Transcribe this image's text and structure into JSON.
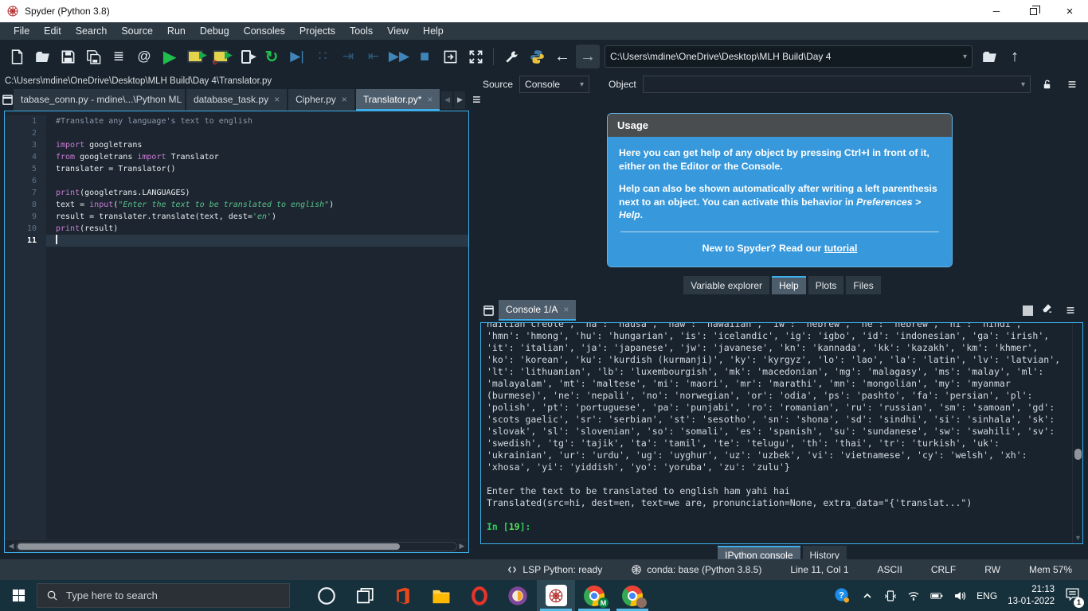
{
  "accent_color": "#3daee9",
  "usage_blue": "#3798dc",
  "window": {
    "title": "Spyder (Python 3.8)"
  },
  "menubar": {
    "items": [
      "File",
      "Edit",
      "Search",
      "Source",
      "Run",
      "Debug",
      "Consoles",
      "Projects",
      "Tools",
      "View",
      "Help"
    ]
  },
  "toolbar": {
    "icons_left": [
      {
        "name": "new-file-icon",
        "shape": "file"
      },
      {
        "name": "open-file-icon",
        "shape": "folder"
      },
      {
        "name": "save-icon",
        "shape": "save"
      },
      {
        "name": "save-all-icon",
        "shape": "saveall"
      },
      {
        "name": "outline-explorer-icon",
        "glyph": "≣",
        "cls": "glyph"
      },
      {
        "name": "symbol-finder-icon",
        "glyph": "@",
        "cls": "glyph"
      },
      {
        "name": "run-file-icon",
        "glyph": "▶",
        "cls": "glyph-green big"
      },
      {
        "name": "run-cell-icon",
        "shape": "cell"
      },
      {
        "name": "run-cell-advance-icon",
        "shape": "celladv"
      },
      {
        "name": "run-selection-icon",
        "shape": "runsel"
      },
      {
        "name": "rerun-icon",
        "glyph": "↻",
        "cls": "glyph-green big"
      },
      {
        "name": "debug-file-icon",
        "glyph": "▶|",
        "cls": "glyph-blue"
      },
      {
        "name": "debug-step-over-icon",
        "glyph": "∷",
        "cls": "glyph-dim"
      },
      {
        "name": "debug-step-into-icon",
        "glyph": "⇥",
        "cls": "glyph-dim"
      },
      {
        "name": "debug-step-return-icon",
        "glyph": "⇤",
        "cls": "glyph-dim"
      },
      {
        "name": "debug-continue-icon",
        "glyph": "▶▶",
        "cls": "glyph-blue"
      },
      {
        "name": "debug-stop-icon",
        "glyph": "■",
        "cls": "glyph-blue big"
      },
      {
        "name": "new-window-icon",
        "shape": "panebox"
      },
      {
        "name": "maximize-pane-icon",
        "shape": "expand"
      }
    ],
    "icons_mid": [
      {
        "name": "preferences-icon",
        "shape": "wrench"
      },
      {
        "name": "python-path-icon",
        "shape": "python"
      }
    ],
    "back_icon": "←",
    "forward_icon": "→",
    "working_dir": "C:\\Users\\mdine\\OneDrive\\Desktop\\MLH Build\\Day 4",
    "open_dir_icon": "folder",
    "up_dir_icon": "↑"
  },
  "editor": {
    "file_path": "C:\\Users\\mdine\\OneDrive\\Desktop\\MLH Build\\Day 4\\Translator.py",
    "tabs": [
      {
        "label": "tabase_conn.py - mdine\\...\\Python ML",
        "active": false
      },
      {
        "label": "database_task.py",
        "active": false
      },
      {
        "label": "Cipher.py",
        "active": false
      },
      {
        "label": "Translator.py*",
        "active": true
      }
    ],
    "current_line": 11,
    "lines": [
      {
        "n": 1,
        "tokens": [
          {
            "t": "cm",
            "s": "#Translate any language's text to english"
          }
        ]
      },
      {
        "n": 2,
        "tokens": []
      },
      {
        "n": 3,
        "tokens": [
          {
            "t": "kw",
            "s": "import"
          },
          {
            "t": "tx",
            "s": " googletrans"
          }
        ]
      },
      {
        "n": 4,
        "tokens": [
          {
            "t": "kw",
            "s": "from"
          },
          {
            "t": "tx",
            "s": " googletrans "
          },
          {
            "t": "kw",
            "s": "import"
          },
          {
            "t": "tx",
            "s": " Translator"
          }
        ]
      },
      {
        "n": 5,
        "tokens": [
          {
            "t": "tx",
            "s": "translater = Translator()"
          }
        ]
      },
      {
        "n": 6,
        "tokens": []
      },
      {
        "n": 7,
        "tokens": [
          {
            "t": "kw",
            "s": "print"
          },
          {
            "t": "tx",
            "s": "(googletrans.LANGUAGES)"
          }
        ]
      },
      {
        "n": 8,
        "tokens": [
          {
            "t": "tx",
            "s": "text = "
          },
          {
            "t": "kw",
            "s": "input"
          },
          {
            "t": "tx",
            "s": "("
          },
          {
            "t": "st",
            "s": "\"Enter the text to be translated to english\""
          },
          {
            "t": "tx",
            "s": ")"
          }
        ]
      },
      {
        "n": 9,
        "tokens": [
          {
            "t": "tx",
            "s": "result = translater.translate(text, dest="
          },
          {
            "t": "st",
            "s": "'en'"
          },
          {
            "t": "tx",
            "s": ")"
          }
        ]
      },
      {
        "n": 10,
        "tokens": [
          {
            "t": "kw",
            "s": "print"
          },
          {
            "t": "tx",
            "s": "(result)"
          }
        ]
      },
      {
        "n": 11,
        "tokens": []
      }
    ]
  },
  "help": {
    "source_label": "Source",
    "source_value": "Console",
    "object_label": "Object",
    "object_value": "",
    "usage": {
      "title": "Usage",
      "p1_pre": "Here you can get help of any object by pressing ",
      "p1_bold": "Ctrl+I",
      "p1_post": " in front of it, either on the Editor or the Console.",
      "p2_pre": "Help can also be shown automatically after writing a left parenthesis next to an object. You can activate this behavior in ",
      "p2_italic": "Preferences > Help",
      "p2_post": ".",
      "footer_pre": "New to Spyder? Read our ",
      "footer_link": "tutorial"
    },
    "tabs": [
      {
        "label": "Variable explorer",
        "active": false
      },
      {
        "label": "Help",
        "active": true
      },
      {
        "label": "Plots",
        "active": false
      },
      {
        "label": "Files",
        "active": false
      }
    ]
  },
  "console": {
    "tab_label": "Console 1/A",
    "lines": [
      "haitian creole', 'ha': 'hausa', 'haw': 'hawaiian', 'iw': 'hebrew', 'he': 'hebrew', 'hi': 'hindi',",
      "'hmn': 'hmong', 'hu': 'hungarian', 'is': 'icelandic', 'ig': 'igbo', 'id': 'indonesian', 'ga': 'irish',",
      "'it': 'italian', 'ja': 'japanese', 'jw': 'javanese', 'kn': 'kannada', 'kk': 'kazakh', 'km': 'khmer',",
      "'ko': 'korean', 'ku': 'kurdish (kurmanji)', 'ky': 'kyrgyz', 'lo': 'lao', 'la': 'latin', 'lv': 'latvian',",
      "'lt': 'lithuanian', 'lb': 'luxembourgish', 'mk': 'macedonian', 'mg': 'malagasy', 'ms': 'malay', 'ml':",
      "'malayalam', 'mt': 'maltese', 'mi': 'maori', 'mr': 'marathi', 'mn': 'mongolian', 'my': 'myanmar",
      "(burmese)', 'ne': 'nepali', 'no': 'norwegian', 'or': 'odia', 'ps': 'pashto', 'fa': 'persian', 'pl':",
      "'polish', 'pt': 'portuguese', 'pa': 'punjabi', 'ro': 'romanian', 'ru': 'russian', 'sm': 'samoan', 'gd':",
      "'scots gaelic', 'sr': 'serbian', 'st': 'sesotho', 'sn': 'shona', 'sd': 'sindhi', 'si': 'sinhala', 'sk':",
      "'slovak', 'sl': 'slovenian', 'so': 'somali', 'es': 'spanish', 'su': 'sundanese', 'sw': 'swahili', 'sv':",
      "'swedish', 'tg': 'tajik', 'ta': 'tamil', 'te': 'telugu', 'th': 'thai', 'tr': 'turkish', 'uk':",
      "'ukrainian', 'ur': 'urdu', 'ug': 'uyghur', 'uz': 'uzbek', 'vi': 'vietnamese', 'cy': 'welsh', 'xh':",
      "'xhosa', 'yi': 'yiddish', 'yo': 'yoruba', 'zu': 'zulu'}",
      "",
      "Enter the text to be translated to english ham yahi hai",
      "Translated(src=hi, dest=en, text=we are, pronunciation=None, extra_data=\"{'translat...\")",
      ""
    ],
    "prompt": {
      "pre": "In [",
      "num": "19",
      "post": "]:"
    },
    "bottom_tabs": [
      {
        "label": "IPython console",
        "active": true
      },
      {
        "label": "History",
        "active": false
      }
    ]
  },
  "statusbar": {
    "items": [
      {
        "icon": "lsp",
        "label": "LSP Python: ready"
      },
      {
        "icon": "conda",
        "label": "conda: base (Python 3.8.5)"
      },
      {
        "icon": "",
        "label": "Line 11, Col 1"
      },
      {
        "icon": "",
        "label": "ASCII"
      },
      {
        "icon": "",
        "label": "CRLF"
      },
      {
        "icon": "",
        "label": "RW"
      },
      {
        "icon": "",
        "label": "Mem 57%"
      }
    ]
  },
  "taskbar": {
    "search_placeholder": "Type here to search",
    "apps": [
      {
        "name": "cortana-icon",
        "shape": "cortana"
      },
      {
        "name": "task-view-icon",
        "shape": "taskview"
      },
      {
        "name": "office-icon",
        "shape": "office"
      },
      {
        "name": "file-explorer-icon",
        "shape": "explorer"
      },
      {
        "name": "opera-icon",
        "shape": "opera"
      },
      {
        "name": "tor-browser-icon",
        "shape": "tor"
      },
      {
        "name": "spyder-taskbar-icon",
        "shape": "spyder",
        "active": true,
        "running": true
      },
      {
        "name": "chrome-profile1-icon",
        "shape": "chrome",
        "badge": "M",
        "running": true
      },
      {
        "name": "chrome-profile2-icon",
        "shape": "chrome",
        "badge2": true,
        "running": true
      }
    ],
    "tray_icons": [
      {
        "name": "help-bubble-icon",
        "shape": "help",
        "cls": "helpb"
      },
      {
        "name": "tray-expand-icon",
        "shape": "chevup"
      },
      {
        "name": "device-link-icon",
        "shape": "device"
      },
      {
        "name": "wifi-icon",
        "shape": "wifi"
      },
      {
        "name": "battery-icon",
        "shape": "battery"
      },
      {
        "name": "volume-icon",
        "shape": "volume"
      }
    ],
    "language": "ENG",
    "time": "21:13",
    "date": "13-01-2022",
    "notification_badge": "1"
  }
}
